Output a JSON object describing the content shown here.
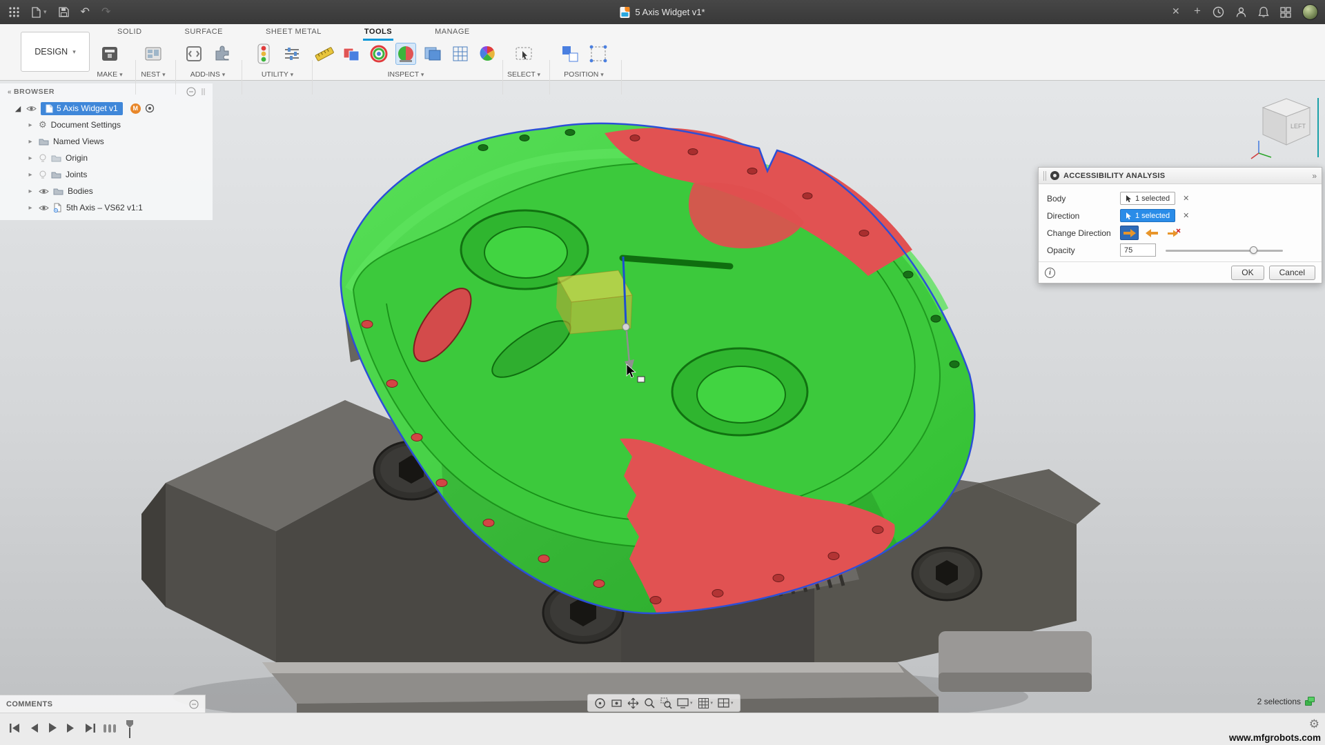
{
  "titlebar": {
    "title": "5 Axis Widget v1*"
  },
  "icons": {
    "caret_down": "▾",
    "close": "✕",
    "plus": "+",
    "undo": "↶",
    "redo": "↷",
    "chevron_collapsed": "▸",
    "chevron_expanded": "◢",
    "panel_arrows": "»",
    "gear": "⚙",
    "info": "i",
    "panel_left": "«"
  },
  "tabs": [
    {
      "label": "SOLID"
    },
    {
      "label": "SURFACE"
    },
    {
      "label": "SHEET METAL"
    },
    {
      "label": "TOOLS"
    },
    {
      "label": "MANAGE"
    }
  ],
  "toolbar": {
    "design": "DESIGN",
    "groups": [
      {
        "label": "MAKE"
      },
      {
        "label": "NEST"
      },
      {
        "label": "ADD-INS"
      },
      {
        "label": "UTILITY"
      },
      {
        "label": "INSPECT"
      },
      {
        "label": "SELECT"
      },
      {
        "label": "POSITION"
      }
    ]
  },
  "browser": {
    "title": "BROWSER",
    "badge": "M",
    "items": [
      {
        "label": "5 Axis Widget v1"
      },
      {
        "label": "Document Settings"
      },
      {
        "label": "Named Views"
      },
      {
        "label": "Origin"
      },
      {
        "label": "Joints"
      },
      {
        "label": "Bodies"
      },
      {
        "label": "5th Axis – VS62 v1:1"
      }
    ]
  },
  "viewcube": {
    "left": "LEFT"
  },
  "dialog": {
    "title": "ACCESSIBILITY ANALYSIS",
    "body_label": "Body",
    "body_value": "1 selected",
    "direction_label": "Direction",
    "direction_value": "1 selected",
    "change_direction_label": "Change Direction",
    "opacity_label": "Opacity",
    "opacity_value": "75",
    "ok": "OK",
    "cancel": "Cancel"
  },
  "comments": {
    "title": "COMMENTS"
  },
  "status": {
    "selections": "2 selections"
  },
  "watermark": "www.mfgrobots.com",
  "colors": {
    "accessible_green": "#3ecf3e",
    "inaccessible_red": "#e15252",
    "selection_blue": "#2b4fd7",
    "accent_blue": "#0696d7"
  }
}
